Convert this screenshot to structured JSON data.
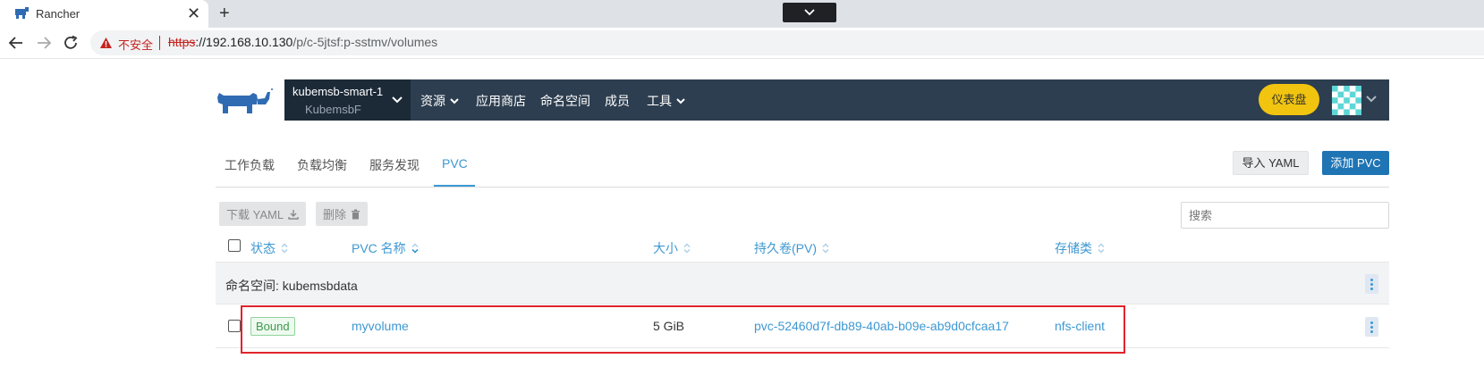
{
  "browser": {
    "tab_title": "Rancher",
    "tab_close": "✕",
    "new_tab": "+",
    "insecure_label": "不安全",
    "url_protocol": "https",
    "url_host": "://192.168.10.130",
    "url_path": "/p/c-5jtsf:p-sstmv/volumes"
  },
  "header": {
    "cluster_name": "kubemsb-smart-1",
    "project_name": "KubemsbF",
    "menu": [
      "资源",
      "应用商店",
      "命名空间",
      "成员",
      "工具"
    ],
    "dashboard_button": "仪表盘"
  },
  "subnav": {
    "tabs": [
      "工作负载",
      "负载均衡",
      "服务发现",
      "PVC"
    ],
    "active_tab": "PVC",
    "import_button": "导入 YAML",
    "add_button": "添加 PVC"
  },
  "toolbar": {
    "download_yaml": "下载 YAML",
    "delete": "删除",
    "search_placeholder": "搜索"
  },
  "table": {
    "columns": [
      "状态",
      "PVC 名称",
      "大小",
      "持久卷(PV)",
      "存储类"
    ],
    "group_label": "命名空间: kubemsbdata",
    "rows": [
      {
        "status": "Bound",
        "name": "myvolume",
        "size": "5 GiB",
        "pv": "pvc-52460d7f-db89-40ab-b09e-ab9d0cfcaa17",
        "storage_class": "nfs-client"
      }
    ]
  },
  "colors": {
    "header_bg": "#2d3e50",
    "accent": "#3d98d3",
    "primary_button": "#1f74b4",
    "dashboard_button": "#f1c40f",
    "status_ok": "#3c9a4c",
    "highlight": "#e2232b"
  }
}
